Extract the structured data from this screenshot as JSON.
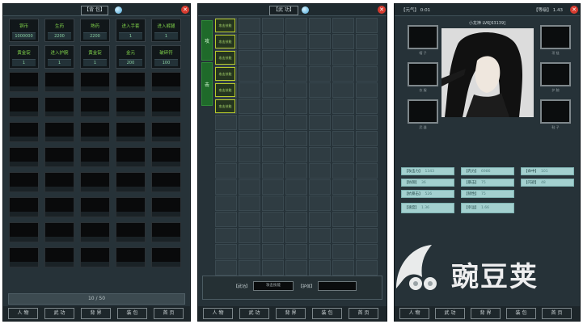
{
  "bag": {
    "title": "【背 包】",
    "stats": [
      {
        "label": "铜币",
        "value": "1000000"
      },
      {
        "label": "生药",
        "value": "2200"
      },
      {
        "label": "熟药",
        "value": "2200"
      },
      {
        "label": "进入手套",
        "value": "1"
      },
      {
        "label": "进入裤腿",
        "value": "1"
      },
      {
        "label": "黄金锭",
        "value": "1"
      },
      {
        "label": "进入护腕",
        "value": "1"
      },
      {
        "label": "黄金锭",
        "value": "1"
      },
      {
        "label": "金元",
        "value": "200"
      },
      {
        "label": "破碎符",
        "value": "100"
      }
    ],
    "page": "10 / 50",
    "nav": [
      "人 物",
      "武 功",
      "背 界",
      "装 包",
      "首 页"
    ]
  },
  "skills": {
    "title": "【武 功】",
    "tabs": [
      "攻",
      "击"
    ],
    "items": [
      "攻击技能",
      "攻击技能",
      "攻击技能",
      "攻击技能",
      "攻击技能",
      "攻击技能"
    ],
    "field1_label": "【武功】",
    "field1_value": "攻击技能",
    "field2_label": "【护体】",
    "field2_value": "",
    "nav": [
      "人 物",
      "武 功",
      "背 界",
      "装 包",
      "首 页"
    ]
  },
  "character": {
    "header_left": "【元气】 0:01",
    "header_right": "【等级】 1.43",
    "name": "小龙神 LV6[63139]",
    "equip_left": [
      "帽 子",
      "衣 服",
      "武 器"
    ],
    "equip_right": [
      "项 链",
      "护 腕",
      "鞋 子"
    ],
    "attrs": [
      {
        "label": "【攻击力】",
        "value": "1343"
      },
      {
        "label": "【内力】",
        "value": "6986"
      },
      {
        "label": "【命中】",
        "value": "101"
      },
      {
        "label": "【防御】",
        "value": "36"
      },
      {
        "label": "【暴击】",
        "value": "75"
      },
      {
        "label": "【闪避】",
        "value": "48"
      },
      {
        "label": "【抗暴击】",
        "value": "526"
      },
      {
        "label": "【韧性】",
        "value": "75"
      },
      {
        "label": "【速度】",
        "value": "1.36"
      },
      {
        "label": "【幸运】",
        "value": "1.66"
      }
    ],
    "nav": [
      "人 物",
      "武 功",
      "背 界",
      "装 包",
      "首 页"
    ]
  },
  "watermark": "豌豆荚"
}
